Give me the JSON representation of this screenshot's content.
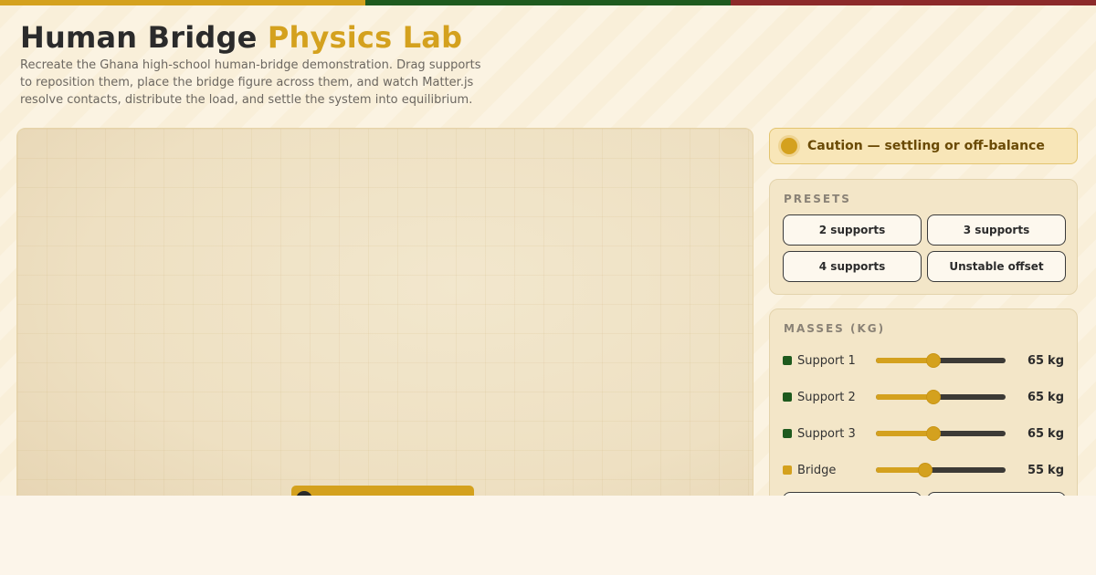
{
  "colors": {
    "gold": "#d4a11e",
    "green": "#1e5a1e",
    "red": "#8c2a2a",
    "flag": [
      "#d4a11e",
      "#1e5a1e",
      "#8c2a2a"
    ]
  },
  "header": {
    "title_main": "Human Bridge",
    "title_accent": "Physics Lab",
    "subtitle": "Recreate the Ghana high-school human-bridge demonstration. Drag supports to reposition them, place the bridge figure across them, and watch Matter.js resolve contacts, distribute the load, and settle the system into equilibrium."
  },
  "status": {
    "text": "Caution — settling or off-balance",
    "icon": "status-dot-icon",
    "level": "caution"
  },
  "presets": {
    "heading": "PRESETS",
    "buttons": [
      "2 supports",
      "3 supports",
      "4 supports",
      "Unstable offset"
    ]
  },
  "masses": {
    "heading": "MASSES (KG)",
    "unit": "kg",
    "min": 0,
    "max": 150,
    "items": [
      {
        "label": "Support 1",
        "value": 65,
        "color": "#1e5a1e"
      },
      {
        "label": "Support 2",
        "value": 65,
        "color": "#1e5a1e"
      },
      {
        "label": "Support 3",
        "value": 65,
        "color": "#1e5a1e"
      },
      {
        "label": "Bridge",
        "value": 55,
        "color": "#d4a11e"
      }
    ]
  }
}
